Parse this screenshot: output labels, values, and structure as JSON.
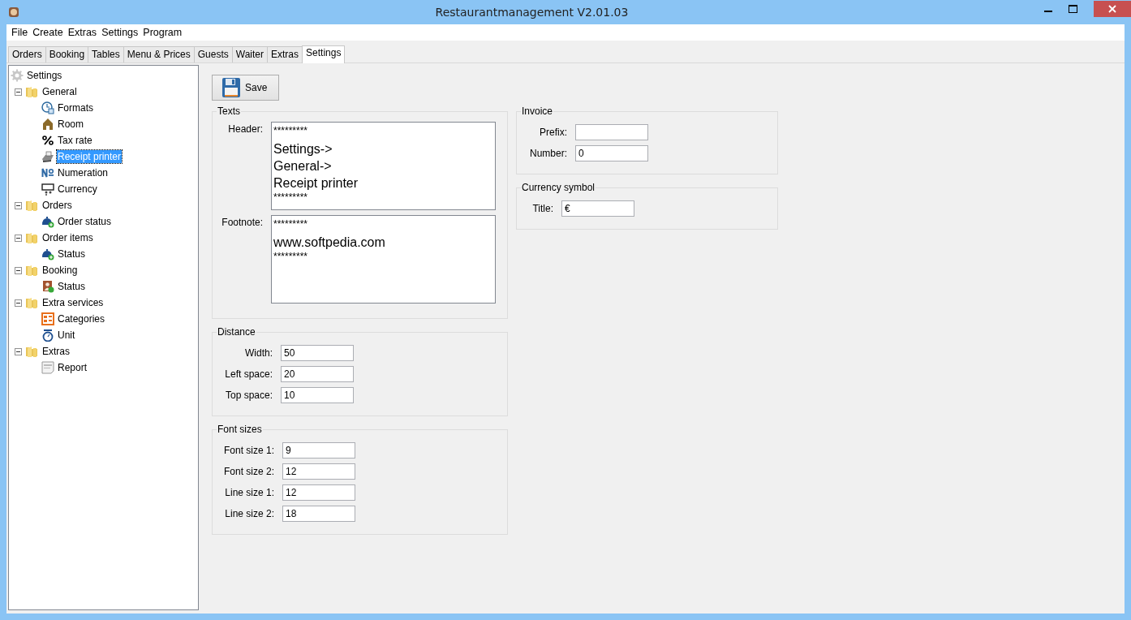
{
  "window": {
    "title": "Restaurantmanagement V2.01.03"
  },
  "menu": [
    "File",
    "Create",
    "Extras",
    "Settings",
    "Program"
  ],
  "tabs": [
    {
      "label": "Orders",
      "selected": false
    },
    {
      "label": "Booking",
      "selected": false
    },
    {
      "label": "Tables",
      "selected": false
    },
    {
      "label": "Menu & Prices",
      "selected": false
    },
    {
      "label": "Guests",
      "selected": false
    },
    {
      "label": "Waiter",
      "selected": false
    },
    {
      "label": "Extras",
      "selected": false
    },
    {
      "label": "Settings",
      "selected": true
    }
  ],
  "tree": {
    "label": "Settings",
    "children": [
      {
        "label": "General",
        "expanded": true,
        "children": [
          {
            "label": "Formats",
            "selected": false
          },
          {
            "label": "Room",
            "selected": false
          },
          {
            "label": "Tax rate",
            "selected": false
          },
          {
            "label": "Receipt printer",
            "selected": true
          },
          {
            "label": "Numeration",
            "selected": false
          },
          {
            "label": "Currency",
            "selected": false
          }
        ]
      },
      {
        "label": "Orders",
        "expanded": true,
        "children": [
          {
            "label": "Order status",
            "selected": false
          }
        ]
      },
      {
        "label": "Order items",
        "expanded": true,
        "children": [
          {
            "label": "Status",
            "selected": false
          }
        ]
      },
      {
        "label": "Booking",
        "expanded": true,
        "children": [
          {
            "label": "Status",
            "selected": false
          }
        ]
      },
      {
        "label": "Extra services",
        "expanded": true,
        "children": [
          {
            "label": "Categories",
            "selected": false
          },
          {
            "label": "Unit",
            "selected": false
          }
        ]
      },
      {
        "label": "Extras",
        "expanded": true,
        "children": [
          {
            "label": "Report",
            "selected": false
          }
        ]
      }
    ]
  },
  "save_button": "Save",
  "texts": {
    "title": "Texts",
    "fields": [
      {
        "label": "Header:",
        "lines": [
          {
            "text": "*********",
            "kind": "small"
          },
          {
            "text": "Settings->",
            "kind": "large"
          },
          {
            "text": "General->",
            "kind": "large"
          },
          {
            "text": "Receipt printer",
            "kind": "large"
          },
          {
            "text": "*********",
            "kind": "small"
          }
        ]
      },
      {
        "label": "Footnote:",
        "lines": [
          {
            "text": "*********",
            "kind": "small"
          },
          {
            "text": "www.softpedia.com",
            "kind": "large"
          },
          {
            "text": "*********",
            "kind": "small"
          }
        ]
      }
    ]
  },
  "distance": {
    "title": "Distance",
    "fields": [
      {
        "label": "Width:",
        "value": "50"
      },
      {
        "label": "Left space:",
        "value": "20"
      },
      {
        "label": "Top space:",
        "value": "10"
      }
    ]
  },
  "font_sizes": {
    "title": "Font sizes",
    "fields": [
      {
        "label": "Font size 1:",
        "value": "9"
      },
      {
        "label": "Font size 2:",
        "value": "12"
      },
      {
        "label": "Line size 1:",
        "value": "12"
      },
      {
        "label": "Line size 2:",
        "value": "18"
      }
    ]
  },
  "invoice": {
    "title": "Invoice",
    "fields": [
      {
        "label": "Prefix:"
      },
      {
        "label": "Number:",
        "value": "0"
      }
    ]
  },
  "currency_symbol": {
    "title": "Currency symbol",
    "fields": [
      {
        "label": "Title:",
        "value": "€"
      }
    ]
  }
}
